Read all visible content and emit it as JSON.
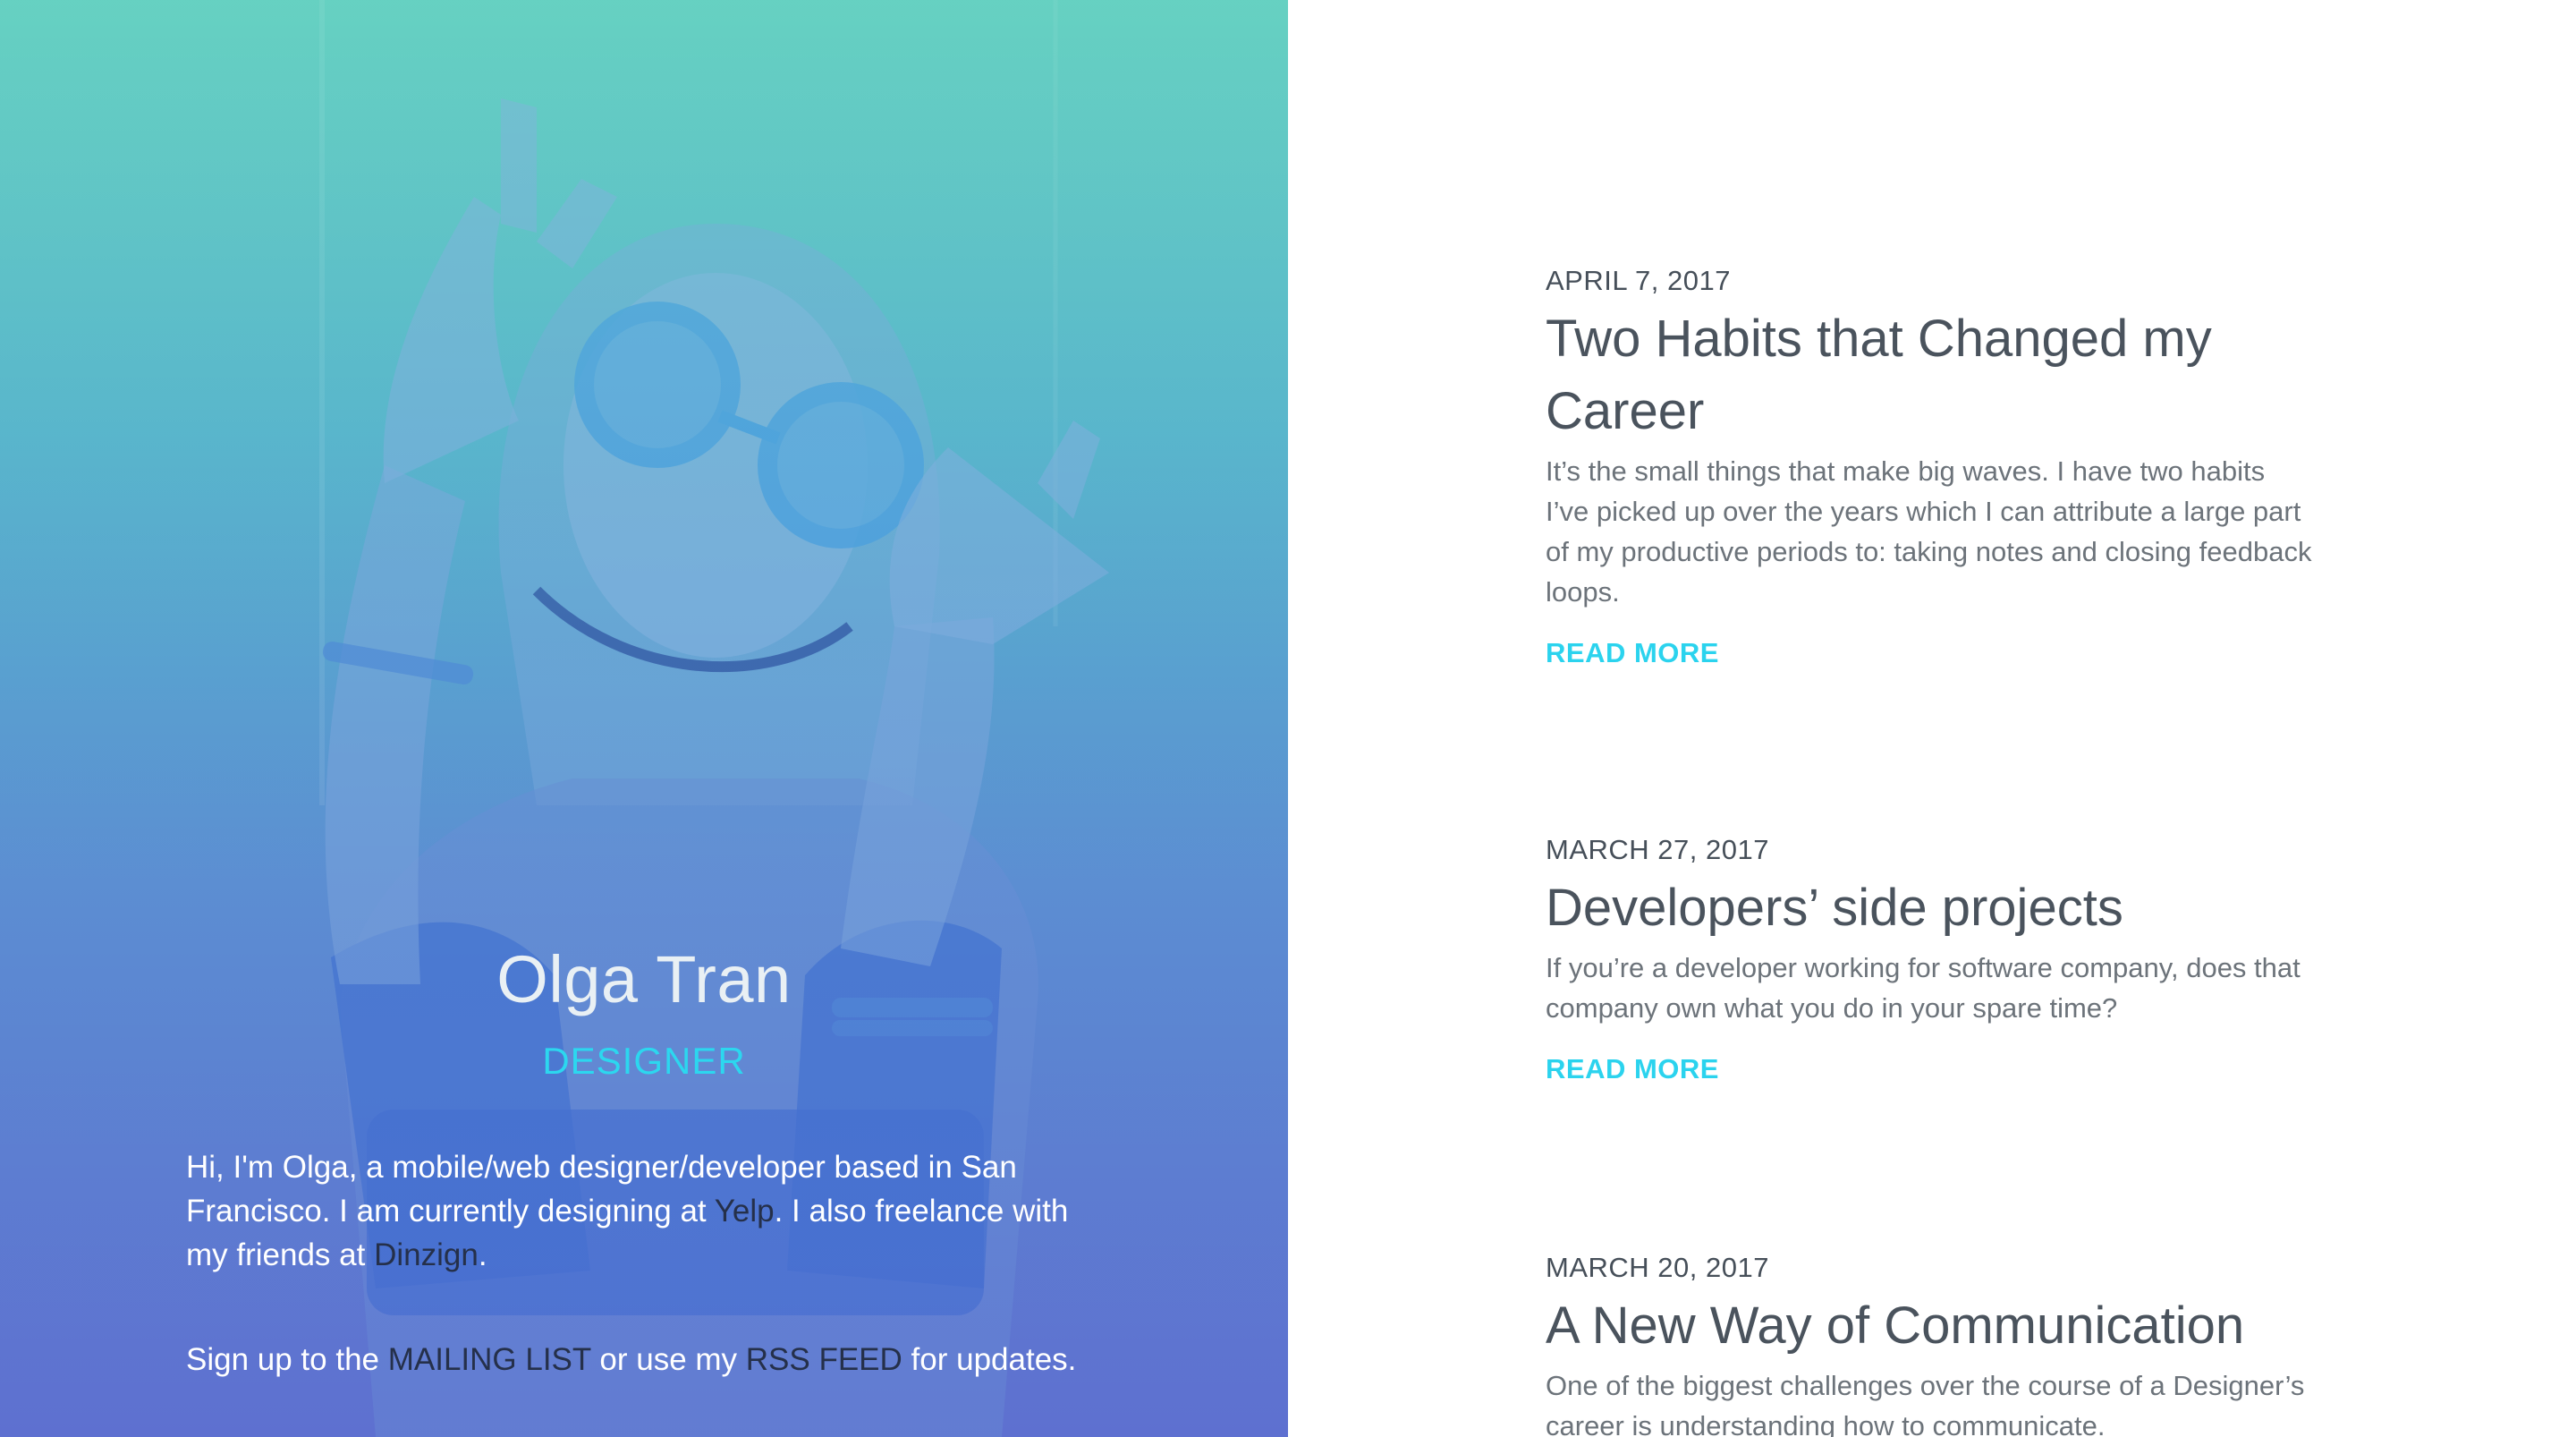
{
  "author": {
    "name": "Olga Tran",
    "role": "DESIGNER",
    "bio_prefix": "Hi, I'm Olga, a mobile/web designer/developer based in San Francisco. I am currently designing at ",
    "employer_link": "Yelp",
    "bio_middle": ". I also freelance with my friends at ",
    "freelance_link": "Dinzign",
    "bio_suffix": ".",
    "signup_prefix": "Sign up to the ",
    "mailing_list_link": "MAILING LIST",
    "signup_middle": " or use my ",
    "rss_link": "RSS FEED",
    "signup_suffix": " for updates."
  },
  "posts": [
    {
      "date": "APRIL 7, 2017",
      "title": "Two Habits that Changed my Career",
      "excerpt": "It’s the small things that make big waves. I have two habits I’ve picked up over the years which I can attribute a large part of my productive periods to: taking notes and closing feedback loops.",
      "read_more": "READ MORE"
    },
    {
      "date": "MARCH 27, 2017",
      "title": "Developers’ side projects",
      "excerpt": "If you’re a developer working for software company, does that company own what you do in your spare time?",
      "read_more": "READ MORE"
    },
    {
      "date": "MARCH 20, 2017",
      "title": "A New Way of Communication",
      "excerpt": "One of the biggest challenges over the course of a Designer’s career is understanding how to communicate."
    }
  ],
  "colors": {
    "accent": "#2bd3ee",
    "hero_top": "#66cfc0",
    "hero_bottom": "#5e70cf",
    "link_dark": "#25304a",
    "heading": "#4a535d",
    "body_text": "#6c737a"
  }
}
